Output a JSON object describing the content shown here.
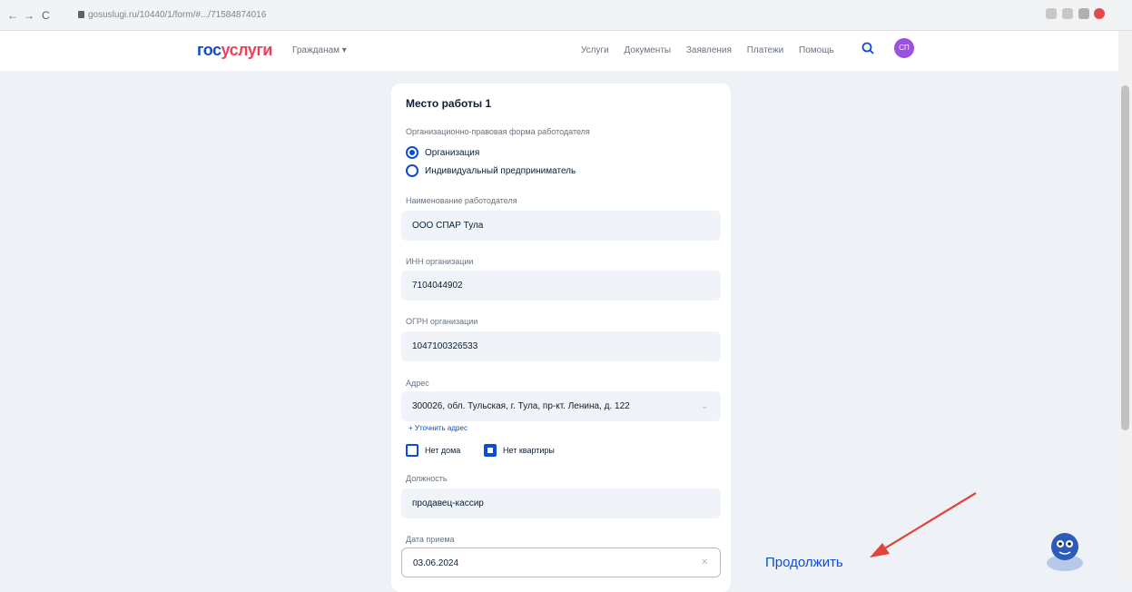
{
  "browser": {
    "back": "←",
    "forward": "→",
    "reload": "C",
    "url": "gosuslugi.ru/10440/1/form/#.../71584874016"
  },
  "header": {
    "logo_part1": "гос",
    "logo_part2": "услуги",
    "citizen_menu": "Гражданам ▾",
    "nav": [
      "Услуги",
      "Документы",
      "Заявления",
      "Платежи",
      "Помощь"
    ],
    "avatar_initials": "СП"
  },
  "form": {
    "title": "Место работы 1",
    "org_form_label": "Организационно-правовая форма работодателя",
    "options": [
      {
        "label": "Организация",
        "selected": true
      },
      {
        "label": "Индивидуальный предприниматель",
        "selected": false
      }
    ],
    "employer_label": "Наименование работодателя",
    "employer_value": "ООО СПАР Тула",
    "inn_label": "ИНН организации",
    "inn_value": "7104044902",
    "ogrn_label": "ОГРН организации",
    "ogrn_value": "1047100326533",
    "address_label": "Адрес",
    "address_value": "300026, обл. Тульская, г. Тула, пр-кт. Ленина, д. 122",
    "clarify_link": "+ Уточнить адрес",
    "no_house_label": "Нет дома",
    "no_house_checked": false,
    "no_apartment_label": "Нет квартиры",
    "no_apartment_checked": true,
    "position_label": "Должность",
    "position_value": "продавец-кассир",
    "hire_date_label": "Дата приема",
    "hire_date_value": "03.06.2024"
  },
  "continue_label": "Продолжить",
  "colors": {
    "primary": "#0d4cd3",
    "accent_red": "#ee3f58",
    "avatar": "#9b51e0",
    "arrow": "#e0443a"
  }
}
